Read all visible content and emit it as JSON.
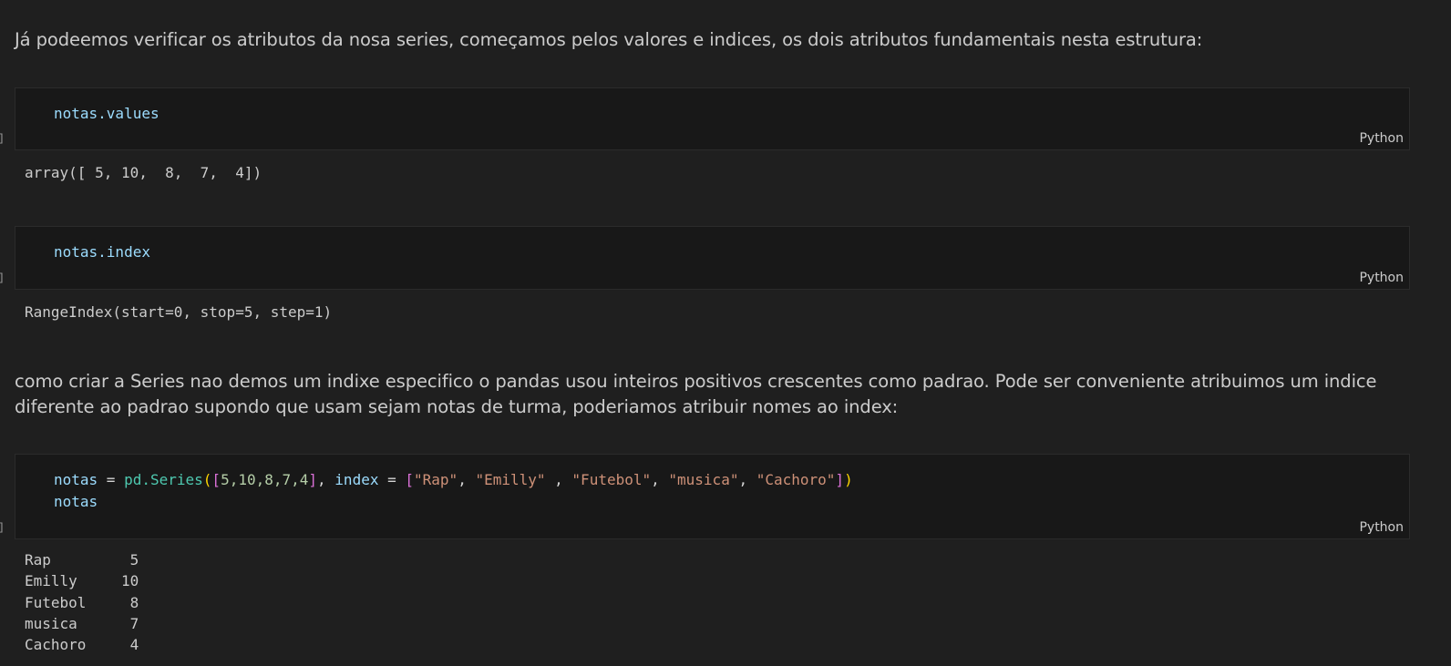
{
  "markdown": {
    "intro": "Já podeemos verificar os atributos da nosa series, começamos pelos valores e indices, os dois atributos fundamentais nesta estrutura:",
    "index_note": "como criar a Series nao demos um indixe especifico o pandas usou inteiros positivos crescentes como padrao. Pode ser conveniente atribuimos um indice diferente ao padrao supondo que usam sejam notas de turma, poderiamos atribuir nomes ao index:"
  },
  "cells": [
    {
      "code": "notas.values",
      "language": "Python",
      "output": "array([ 5, 10,  8,  7,  4])"
    },
    {
      "code": "notas.index",
      "language": "Python",
      "output": "RangeIndex(start=0, stop=5, step=1)"
    },
    {
      "code_tokens": {
        "var": "notas",
        "assign": " = ",
        "module": "pd.",
        "func": "Series",
        "open_paren": "(",
        "open_list": "[",
        "nums": "5,10,8,7,4",
        "close_list": "]",
        "kw_sep": ", ",
        "kw": "index",
        "kw_assign": " = ",
        "idx_open": "[",
        "s1": "\"Rap\"",
        "c1": ", ",
        "s2": "\"Emilly\"",
        "c2": " , ",
        "s3": "\"Futebol\"",
        "c3": ", ",
        "s4": "\"musica\"",
        "c4": ", ",
        "s5": "\"Cachoro\"",
        "idx_close": "]",
        "close_paren": ")",
        "line2": "notas"
      },
      "language": "Python",
      "output": "Rap         5\nEmilly     10\nFutebol     8\nmusica      7\nCachoro     4"
    }
  ]
}
